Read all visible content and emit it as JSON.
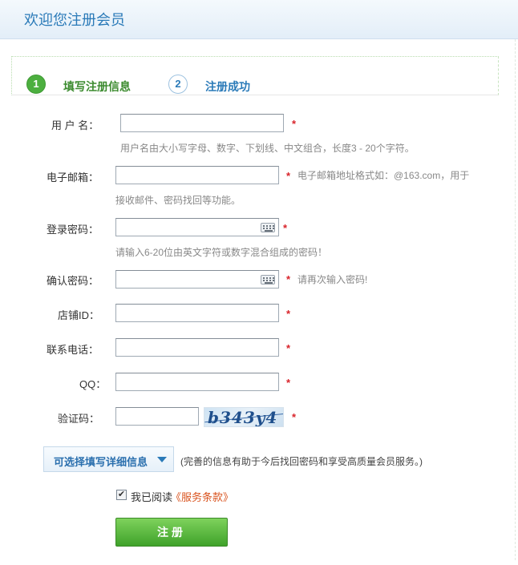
{
  "header": {
    "title": "欢迎您注册会员"
  },
  "steps": [
    {
      "number": "1",
      "label": "填写注册信息"
    },
    {
      "number": "2",
      "label": "注册成功"
    }
  ],
  "form": {
    "username": {
      "label": "用 户 名：",
      "value": "",
      "required": "*",
      "hint": "用户名由大小写字母、数字、下划线、中文组合，长度3 - 20个字符。"
    },
    "email": {
      "label": "电子邮箱：",
      "value": "",
      "required": "*",
      "hint_line1": "电子邮箱地址格式如：@163.com，用于",
      "hint_line2": "接收邮件、密码找回等功能。"
    },
    "password": {
      "label": "登录密码：",
      "value": "",
      "required": "*",
      "hint": "请输入6-20位由英文字符或数字混合组成的密码！"
    },
    "confirm_password": {
      "label": "确认密码：",
      "value": "",
      "required": "*",
      "hint": "请再次输入密码!"
    },
    "shop_id": {
      "label": "店铺ID：",
      "value": "",
      "required": "*"
    },
    "phone": {
      "label": "联系电话：",
      "value": "",
      "required": "*"
    },
    "qq": {
      "label": "QQ：",
      "value": "",
      "required": "*"
    },
    "captcha": {
      "label": "验证码：",
      "value": "",
      "image_text": "b343y4",
      "required": "*"
    }
  },
  "details": {
    "button_label": "可选择填写详细信息",
    "note": "(完善的信息有助于今后找回密码和享受高质量会员服务。)"
  },
  "agreement": {
    "checked": true,
    "check_mark": "✔",
    "text": "我已阅读",
    "link": "《服务条款》"
  },
  "submit": {
    "label": "注册"
  },
  "colors": {
    "accent_green": "#4caf3f",
    "link_blue": "#2a7ab8",
    "required_red": "#d8232a",
    "terms_orange": "#d9531e"
  },
  "icons": {
    "keyboard": "keyboard-icon",
    "dropdown": "chevron-down-icon"
  }
}
